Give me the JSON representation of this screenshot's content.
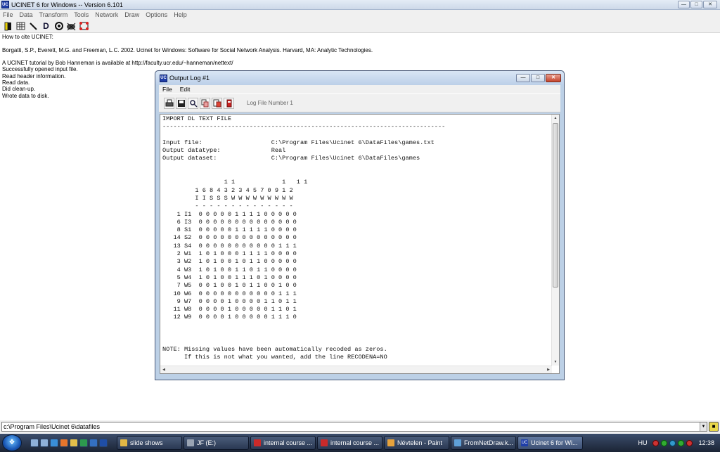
{
  "main_window": {
    "app_icon": "ucinet-icon",
    "title": "UCINET 6 for Windows -- Version 6.101",
    "menu": [
      "File",
      "Data",
      "Transform",
      "Tools",
      "Network",
      "Draw",
      "Options",
      "Help"
    ],
    "toolbar_icons": [
      "matrix-editor-icon",
      "spreadsheet-icon",
      "line-draw-icon",
      "d-icon",
      "netdraw-icon",
      "mage-icon",
      "pajek-icon"
    ],
    "toolbar_labels": [
      "",
      "",
      "",
      "D",
      "",
      "",
      ""
    ]
  },
  "content": {
    "cite_heading": "How to cite UCINET:",
    "citation": "Borgatti, S.P., Everett, M.G. and Freeman, L.C. 2002. Ucinet for Windows: Software for Social Network Analysis. Harvard, MA: Analytic Technologies.",
    "tutorial": "A UCINET tutorial by Bob Hanneman is available at http://faculty.ucr.edu/~hanneman/nettext/",
    "status": [
      "Successfully opened input file.",
      "Read header information.",
      "Read data.",
      "Did clean-up.",
      "Wrote data to disk."
    ]
  },
  "path_bar": {
    "value": "c:\\Program Files\\Ucinet 6\\datafiles"
  },
  "dialog": {
    "title": "Output Log #1",
    "menu": [
      "File",
      "Edit"
    ],
    "toolbar_icons": [
      "print-icon",
      "save-icon",
      "find-icon",
      "copy-icon",
      "paste-icon",
      "exit-icon"
    ],
    "log_number": "Log File Number 1",
    "log_lines": [
      "IMPORT DL TEXT FILE",
      "------------------------------------------------------------------------------",
      "",
      "Input file:                   C:\\Program Files\\Ucinet 6\\DataFiles\\games.txt",
      "Output datatype:              Real",
      "Output dataset:               C:\\Program Files\\Ucinet 6\\DataFiles\\games",
      "",
      "",
      "                 1 1             1   1 1",
      "         1 6 8 4 3 2 3 4 5 7 0 9 1 2",
      "         I I S S S W W W W W W W W W",
      "         - - - - - - - - - - - - - -",
      "    1 I1  0 0 0 0 0 1 1 1 1 0 0 0 0 0",
      "    6 I3  0 0 0 0 0 0 0 0 0 0 0 0 0 0",
      "    8 S1  0 0 0 0 0 1 1 1 1 1 0 0 0 0",
      "   14 S2  0 0 0 0 0 0 0 0 0 0 0 0 0 0",
      "   13 S4  0 0 0 0 0 0 0 0 0 0 0 1 1 1",
      "    2 W1  1 0 1 0 0 0 1 1 1 1 0 0 0 0",
      "    3 W2  1 0 1 0 0 1 0 1 1 0 0 0 0 0",
      "    4 W3  1 0 1 0 0 1 1 0 1 1 0 0 0 0",
      "    5 W4  1 0 1 0 0 1 1 1 0 1 0 0 0 0",
      "    7 W5  0 0 1 0 0 1 0 1 1 0 0 1 0 0",
      "   10 W6  0 0 0 0 0 0 0 0 0 0 0 1 1 1",
      "    9 W7  0 0 0 0 1 0 0 0 0 1 1 0 1 1",
      "   11 W8  0 0 0 0 1 0 0 0 0 0 1 1 0 1",
      "   12 W9  0 0 0 0 1 0 0 0 0 0 1 1 1 0",
      "",
      "",
      "",
      "NOTE: Missing values have been automatically recoded as zeros.",
      "      If this is not what you wanted, add the line RECODENA=NO"
    ]
  },
  "taskbar": {
    "start_icon": "windows-start-icon",
    "quicklaunch_icons": [
      "show-desktop-icon",
      "switch-windows-icon",
      "ie-icon",
      "firefox-icon",
      "explorer-icon",
      "media-icon",
      "outlook-icon",
      "word-icon"
    ],
    "buttons": [
      {
        "label": "slide shows",
        "icon": "folder-icon",
        "active": false
      },
      {
        "label": "JF (E:)",
        "icon": "drive-icon",
        "active": false
      },
      {
        "label": "internal course ...",
        "icon": "acrobat-icon",
        "active": false
      },
      {
        "label": "internal course ...",
        "icon": "acrobat-icon",
        "active": false
      },
      {
        "label": "Névtelen - Paint",
        "icon": "paint-icon",
        "active": false
      },
      {
        "label": "FromNetDraw.k...",
        "icon": "image-icon",
        "active": false
      },
      {
        "label": "Ucinet 6 for Wi...",
        "icon": "ucinet-icon",
        "active": true
      }
    ],
    "language": "HU",
    "clock": "12:38"
  }
}
